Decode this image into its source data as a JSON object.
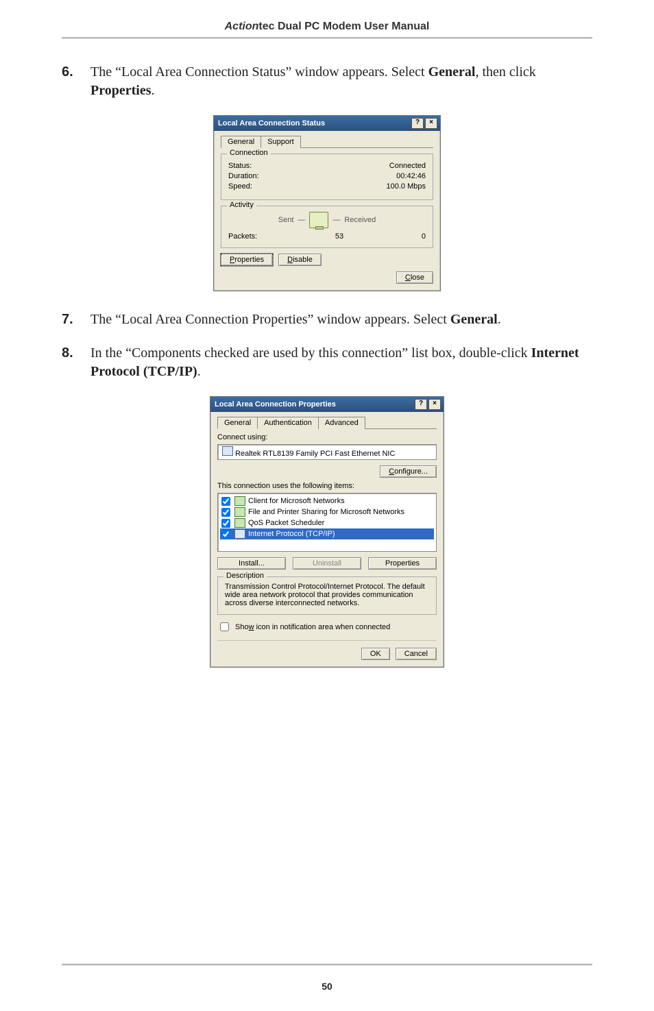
{
  "header": {
    "brand_italic": "Action",
    "brand_rest": "tec",
    "title_rest": " Dual PC Modem User Manual"
  },
  "steps": {
    "s6": {
      "num": "6.",
      "pre": "The “Local Area Connection Status” window appears. Select ",
      "b1": "General",
      "mid": ", then click ",
      "b2": "Properties",
      "post": "."
    },
    "s7": {
      "num": "7.",
      "pre": "The “Local Area Connection Properties” window appears. Select ",
      "b1": "General",
      "post": "."
    },
    "s8": {
      "num": "8.",
      "pre": "In the “Components checked are used by this connection” list box, double-click ",
      "b1": "Internet Protocol ",
      "paren": "(TCP/IP)",
      "post": "."
    }
  },
  "dlg1": {
    "title": "Local Area Connection Status",
    "help": "?",
    "close": "×",
    "tabs": {
      "general": "General",
      "support": "Support"
    },
    "grp_connection": {
      "legend": "Connection",
      "status_k": "Status:",
      "status_v": "Connected",
      "duration_k": "Duration:",
      "duration_v": "00:42:46",
      "speed_k": "Speed:",
      "speed_v": "100.0 Mbps"
    },
    "grp_activity": {
      "legend": "Activity",
      "sent": "Sent",
      "dash": "—",
      "received": "Received",
      "packets_k": "Packets:",
      "sent_v": "53",
      "recv_v": "0"
    },
    "btn_properties": "Properties",
    "btn_disable": "Disable",
    "btn_close": "Close"
  },
  "dlg2": {
    "title": "Local Area Connection Properties",
    "help": "?",
    "close": "×",
    "tabs": {
      "general": "General",
      "auth": "Authentication",
      "adv": "Advanced"
    },
    "connect_using": "Connect using:",
    "nic": "Realtek RTL8139 Family PCI Fast Ethernet NIC",
    "btn_configure": "Configure...",
    "list_label": "This connection uses the following items:",
    "items": {
      "i0": "Client for Microsoft Networks",
      "i1": "File and Printer Sharing for Microsoft Networks",
      "i2": "QoS Packet Scheduler",
      "i3": "Internet Protocol (TCP/IP)"
    },
    "btn_install": "Install...",
    "btn_uninstall": "Uninstall",
    "btn_props": "Properties",
    "desc_legend": "Description",
    "desc_text": "Transmission Control Protocol/Internet Protocol. The default wide area network protocol that provides communication across diverse interconnected networks.",
    "show_icon": "Show icon in notification area when connected",
    "btn_ok": "OK",
    "btn_cancel": "Cancel"
  },
  "footer": {
    "page": "50"
  }
}
